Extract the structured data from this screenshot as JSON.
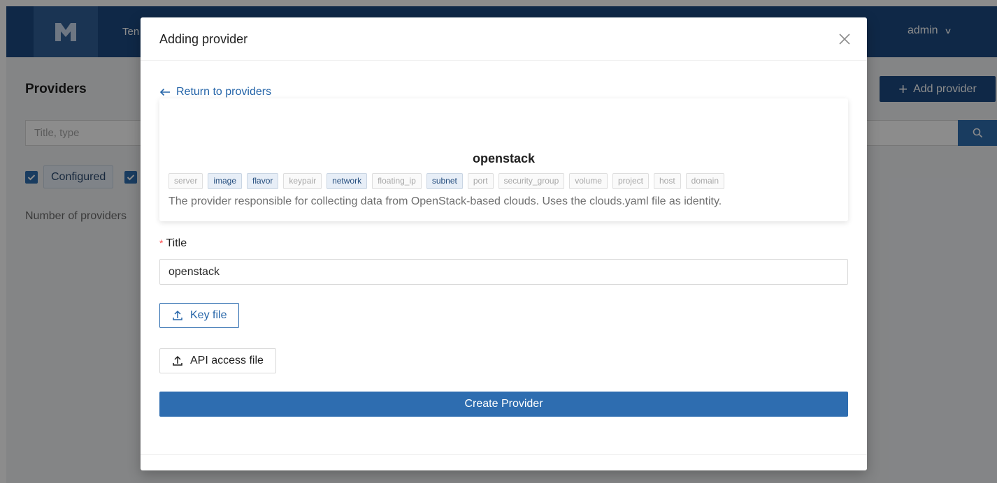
{
  "app": {
    "nav_first_partial": "Ten",
    "user": "admin",
    "page_title": "Providers",
    "add_button": "Add provider",
    "search_placeholder": "Title, type",
    "filter_configured": "Configured",
    "count_label_partial": "Number of providers"
  },
  "modal": {
    "title": "Adding provider",
    "back_link": "Return to providers",
    "provider": {
      "name": "openstack",
      "capabilities": [
        {
          "label": "server",
          "active": false
        },
        {
          "label": "image",
          "active": true
        },
        {
          "label": "flavor",
          "active": true
        },
        {
          "label": "keypair",
          "active": false
        },
        {
          "label": "network",
          "active": true
        },
        {
          "label": "floating_ip",
          "active": false
        },
        {
          "label": "subnet",
          "active": true
        },
        {
          "label": "port",
          "active": false
        },
        {
          "label": "security_group",
          "active": false
        },
        {
          "label": "volume",
          "active": false
        },
        {
          "label": "project",
          "active": false
        },
        {
          "label": "host",
          "active": false
        },
        {
          "label": "domain",
          "active": false
        }
      ],
      "description": "The provider responsible for collecting data from OpenStack-based clouds. Uses the clouds.yaml file as identity."
    },
    "title_field": {
      "required_mark": "*",
      "label": "Title",
      "value": "openstack"
    },
    "key_file_button": "Key file",
    "api_access_file_button": "API access file",
    "create_button": "Create Provider"
  },
  "colors": {
    "primary": "#2e6db0",
    "header": "#1c4a82",
    "required": "#ff4d4f"
  }
}
